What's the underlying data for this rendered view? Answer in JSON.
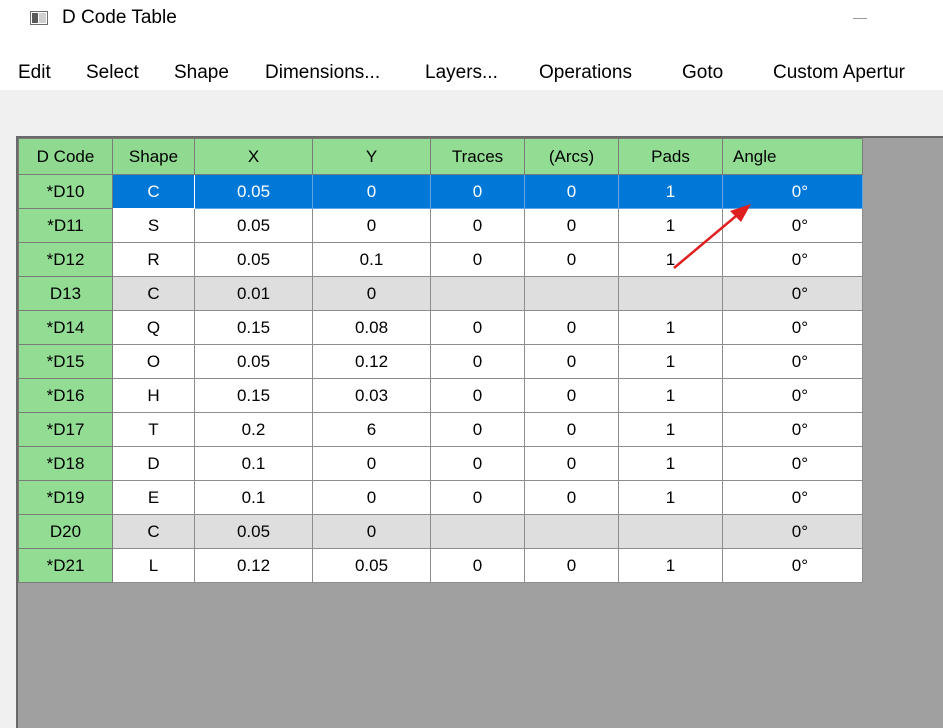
{
  "window": {
    "title": "D Code Table",
    "icon": "window-app-icon",
    "minimize_icon": "minimize-icon"
  },
  "menu": [
    "Edit",
    "Select",
    "Shape",
    "Dimensions...",
    "Layers...",
    "Operations",
    "Goto",
    "Custom Apertur"
  ],
  "table": {
    "headers": [
      "D Code",
      "Shape",
      "X",
      "Y",
      "Traces",
      "(Arcs)",
      "Pads",
      "Angle"
    ],
    "rows": [
      {
        "code": "*D10",
        "shape": "C",
        "x": "0.05",
        "y": "0",
        "traces": "0",
        "arcs": "0",
        "pads": "1",
        "angle": "0°",
        "state": "selected"
      },
      {
        "code": "*D11",
        "shape": "S",
        "x": "0.05",
        "y": "0",
        "traces": "0",
        "arcs": "0",
        "pads": "1",
        "angle": "0°",
        "state": "normal"
      },
      {
        "code": "*D12",
        "shape": "R",
        "x": "0.05",
        "y": "0.1",
        "traces": "0",
        "arcs": "0",
        "pads": "1",
        "angle": "0°",
        "state": "normal"
      },
      {
        "code": "D13",
        "shape": "C",
        "x": "0.01",
        "y": "0",
        "traces": "",
        "arcs": "",
        "pads": "",
        "angle": "0°",
        "state": "disabled"
      },
      {
        "code": "*D14",
        "shape": "Q",
        "x": "0.15",
        "y": "0.08",
        "traces": "0",
        "arcs": "0",
        "pads": "1",
        "angle": "0°",
        "state": "normal"
      },
      {
        "code": "*D15",
        "shape": "O",
        "x": "0.05",
        "y": "0.12",
        "traces": "0",
        "arcs": "0",
        "pads": "1",
        "angle": "0°",
        "state": "normal"
      },
      {
        "code": "*D16",
        "shape": "H",
        "x": "0.15",
        "y": "0.03",
        "traces": "0",
        "arcs": "0",
        "pads": "1",
        "angle": "0°",
        "state": "normal"
      },
      {
        "code": "*D17",
        "shape": "T",
        "x": "0.2",
        "y": "6",
        "traces": "0",
        "arcs": "0",
        "pads": "1",
        "angle": "0°",
        "state": "normal"
      },
      {
        "code": "*D18",
        "shape": "D",
        "x": "0.1",
        "y": "0",
        "traces": "0",
        "arcs": "0",
        "pads": "1",
        "angle": "0°",
        "state": "normal"
      },
      {
        "code": "*D19",
        "shape": "E",
        "x": "0.1",
        "y": "0",
        "traces": "0",
        "arcs": "0",
        "pads": "1",
        "angle": "0°",
        "state": "normal"
      },
      {
        "code": "D20",
        "shape": "C",
        "x": "0.05",
        "y": "0",
        "traces": "",
        "arcs": "",
        "pads": "",
        "angle": "0°",
        "state": "disabled"
      },
      {
        "code": "*D21",
        "shape": "L",
        "x": "0.12",
        "y": "0.05",
        "traces": "0",
        "arcs": "0",
        "pads": "1",
        "angle": "0°",
        "state": "normal"
      }
    ]
  },
  "annotation": {
    "arrow_color": "#e02020",
    "icon": "red-arrow-annotation"
  },
  "colors": {
    "header": "#92dd93",
    "selection": "#0078d7",
    "disabled_row": "#dedede",
    "background": "#a0a0a0"
  }
}
